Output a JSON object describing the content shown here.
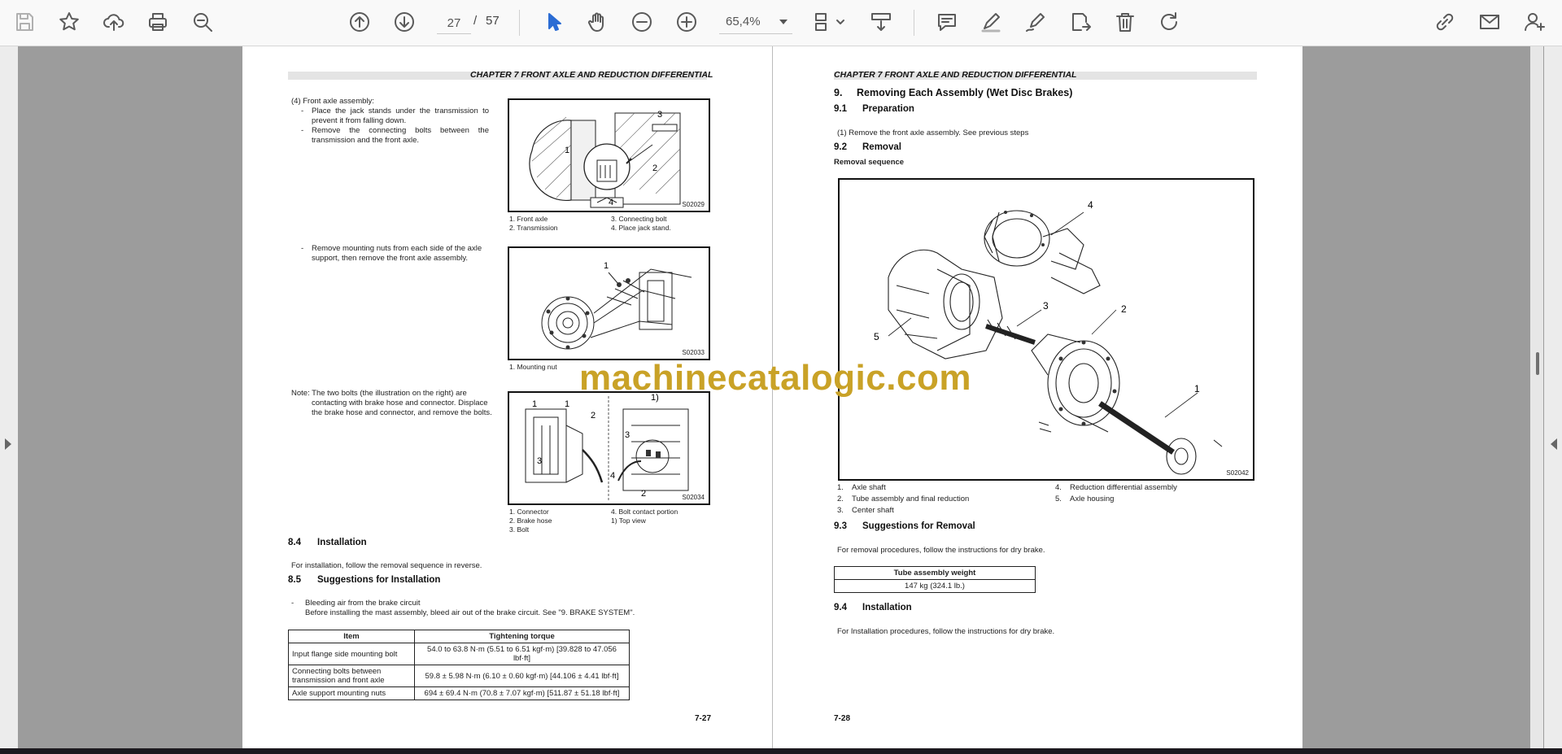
{
  "toolbar": {
    "icons": [
      "save-icon",
      "bookmark-star-icon",
      "upload-cloud-icon",
      "print-icon",
      "zoom-marquee-icon",
      "previous-page-icon",
      "next-page-icon",
      "select-cursor-icon",
      "hand-icon",
      "zoom-out-icon",
      "zoom-in-icon",
      "page-display-icon",
      "download-icon",
      "comment-icon",
      "highlight-pen-icon",
      "sign-icon",
      "send-file-icon",
      "delete-icon",
      "rotate-icon",
      "share-link-icon",
      "email-icon",
      "user-add-icon"
    ],
    "current_page": "27",
    "page_separator": "/",
    "total_pages": "57",
    "zoom": "65,4%"
  },
  "left_page": {
    "header": "CHAPTER 7 FRONT AXLE AND REDUCTION DIFFERENTIAL",
    "step4_title": "(4)   Front axle assembly:",
    "step4_bullet1_line1": "Place  the  jack  stands  under  the  transmission  to",
    "step4_bullet1_line2": "prevent it from falling down.",
    "step4_bullet2_line1": "Remove   the   connecting   bolts   between   the",
    "step4_bullet2_line2": "transmission and the front axle.",
    "dash": "-",
    "fig1": {
      "code": "S02029",
      "labels": [
        "1",
        "2",
        "3",
        "4"
      ],
      "caption_col1": [
        "1. Front axle",
        "2. Transmission"
      ],
      "caption_col2": [
        "3. Connecting bolt",
        "4. Place jack stand."
      ]
    },
    "step_mount_line1": "Remove mounting nuts from each side of the axle",
    "step_mount_line2": "support, then remove the front axle assembly.",
    "fig2": {
      "code": "S02033",
      "labels": [
        "1"
      ],
      "caption": "1. Mounting nut"
    },
    "note_line1": "Note: The two bolts (the illustration on the right) are",
    "note_line2": "contacting with brake hose and connector. Displace",
    "note_line3": "the brake hose and connector, and remove the bolts.",
    "fig3": {
      "code": "S02034",
      "labels": [
        "1",
        "2",
        "3",
        "1",
        "1)",
        "3",
        "4",
        "2"
      ],
      "caption_col1": [
        "1. Connector",
        "2. Brake hose",
        "3. Bolt"
      ],
      "caption_col2": [
        "4. Bolt contact portion",
        "1) Top view"
      ]
    },
    "sec84_num": "8.4",
    "sec84_title": "Installation",
    "sec84_text": "For installation, follow the removal sequence in reverse.",
    "sec85_num": "8.5",
    "sec85_title": "Suggestions for Installation",
    "sec85_bullet": "Bleeding air from the brake circuit",
    "sec85_text": "Before installing the mast assembly, bleed air out of the brake circuit. See \"9. BRAKE SYSTEM\".",
    "table": {
      "headers": [
        "Item",
        "Tightening torque"
      ],
      "rows": [
        [
          "Input flange side mounting bolt",
          "54.0 to 63.8 N·m (5.51 to 6.51 kgf·m) [39.828 to 47.056 lbf·ft]"
        ],
        [
          "Connecting bolts between transmission and front axle",
          "59.8 ± 5.98 N·m (6.10 ± 0.60 kgf·m) [44.106 ± 4.41 lbf·ft]"
        ],
        [
          "Axle support mounting nuts",
          "694 ± 69.4 N·m (70.8 ± 7.07 kgf·m) [511.87 ± 51.18 lbf·ft]"
        ]
      ]
    },
    "page_number": "7-27"
  },
  "right_page": {
    "header": "CHAPTER 7 FRONT AXLE AND REDUCTION DIFFERENTIAL",
    "sec9_num": "9.",
    "sec9_title": "Removing Each Assembly (Wet Disc Brakes)",
    "sec91_num": "9.1",
    "sec91_title": "Preparation",
    "sec91_text": "(1)   Remove the front axle assembly. See previous steps",
    "sec92_num": "9.2",
    "sec92_title": "Removal",
    "removal_sequence": "Removal sequence",
    "fig": {
      "code": "S02042",
      "labels": [
        "4",
        "3",
        "2",
        "5",
        "1"
      ]
    },
    "legend_col1": [
      {
        "n": "1.",
        "t": "Axle shaft"
      },
      {
        "n": "2.",
        "t": "Tube assembly and final reduction"
      },
      {
        "n": "3.",
        "t": "Center shaft"
      }
    ],
    "legend_col2": [
      {
        "n": "4.",
        "t": "Reduction differential assembly"
      },
      {
        "n": "5.",
        "t": "Axle housing"
      }
    ],
    "sec93_num": "9.3",
    "sec93_title": "Suggestions for Removal",
    "sec93_text": "For removal procedures, follow the instructions for dry brake.",
    "weight_header": "Tube assembly weight",
    "weight_value": "147 kg (324.1 lb.)",
    "sec94_num": "9.4",
    "sec94_title": "Installation",
    "sec94_text": "For Installation procedures, follow the instructions for dry brake.",
    "page_number": "7-28"
  },
  "watermark": "machinecatalogic.com"
}
